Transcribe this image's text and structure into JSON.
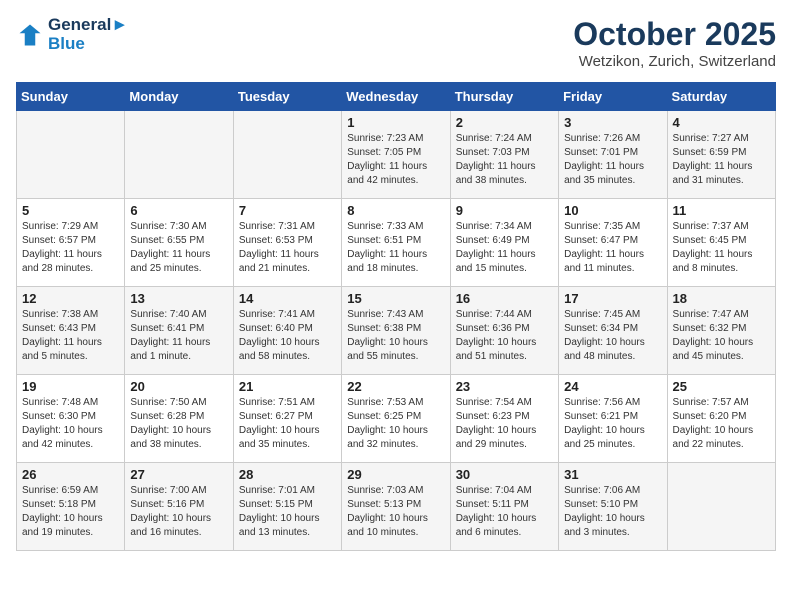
{
  "header": {
    "logo_line1": "General",
    "logo_line2": "Blue",
    "month": "October 2025",
    "location": "Wetzikon, Zurich, Switzerland"
  },
  "days_of_week": [
    "Sunday",
    "Monday",
    "Tuesday",
    "Wednesday",
    "Thursday",
    "Friday",
    "Saturday"
  ],
  "weeks": [
    [
      {
        "day": "",
        "info": ""
      },
      {
        "day": "",
        "info": ""
      },
      {
        "day": "",
        "info": ""
      },
      {
        "day": "1",
        "info": "Sunrise: 7:23 AM\nSunset: 7:05 PM\nDaylight: 11 hours\nand 42 minutes."
      },
      {
        "day": "2",
        "info": "Sunrise: 7:24 AM\nSunset: 7:03 PM\nDaylight: 11 hours\nand 38 minutes."
      },
      {
        "day": "3",
        "info": "Sunrise: 7:26 AM\nSunset: 7:01 PM\nDaylight: 11 hours\nand 35 minutes."
      },
      {
        "day": "4",
        "info": "Sunrise: 7:27 AM\nSunset: 6:59 PM\nDaylight: 11 hours\nand 31 minutes."
      }
    ],
    [
      {
        "day": "5",
        "info": "Sunrise: 7:29 AM\nSunset: 6:57 PM\nDaylight: 11 hours\nand 28 minutes."
      },
      {
        "day": "6",
        "info": "Sunrise: 7:30 AM\nSunset: 6:55 PM\nDaylight: 11 hours\nand 25 minutes."
      },
      {
        "day": "7",
        "info": "Sunrise: 7:31 AM\nSunset: 6:53 PM\nDaylight: 11 hours\nand 21 minutes."
      },
      {
        "day": "8",
        "info": "Sunrise: 7:33 AM\nSunset: 6:51 PM\nDaylight: 11 hours\nand 18 minutes."
      },
      {
        "day": "9",
        "info": "Sunrise: 7:34 AM\nSunset: 6:49 PM\nDaylight: 11 hours\nand 15 minutes."
      },
      {
        "day": "10",
        "info": "Sunrise: 7:35 AM\nSunset: 6:47 PM\nDaylight: 11 hours\nand 11 minutes."
      },
      {
        "day": "11",
        "info": "Sunrise: 7:37 AM\nSunset: 6:45 PM\nDaylight: 11 hours\nand 8 minutes."
      }
    ],
    [
      {
        "day": "12",
        "info": "Sunrise: 7:38 AM\nSunset: 6:43 PM\nDaylight: 11 hours\nand 5 minutes."
      },
      {
        "day": "13",
        "info": "Sunrise: 7:40 AM\nSunset: 6:41 PM\nDaylight: 11 hours\nand 1 minute."
      },
      {
        "day": "14",
        "info": "Sunrise: 7:41 AM\nSunset: 6:40 PM\nDaylight: 10 hours\nand 58 minutes."
      },
      {
        "day": "15",
        "info": "Sunrise: 7:43 AM\nSunset: 6:38 PM\nDaylight: 10 hours\nand 55 minutes."
      },
      {
        "day": "16",
        "info": "Sunrise: 7:44 AM\nSunset: 6:36 PM\nDaylight: 10 hours\nand 51 minutes."
      },
      {
        "day": "17",
        "info": "Sunrise: 7:45 AM\nSunset: 6:34 PM\nDaylight: 10 hours\nand 48 minutes."
      },
      {
        "day": "18",
        "info": "Sunrise: 7:47 AM\nSunset: 6:32 PM\nDaylight: 10 hours\nand 45 minutes."
      }
    ],
    [
      {
        "day": "19",
        "info": "Sunrise: 7:48 AM\nSunset: 6:30 PM\nDaylight: 10 hours\nand 42 minutes."
      },
      {
        "day": "20",
        "info": "Sunrise: 7:50 AM\nSunset: 6:28 PM\nDaylight: 10 hours\nand 38 minutes."
      },
      {
        "day": "21",
        "info": "Sunrise: 7:51 AM\nSunset: 6:27 PM\nDaylight: 10 hours\nand 35 minutes."
      },
      {
        "day": "22",
        "info": "Sunrise: 7:53 AM\nSunset: 6:25 PM\nDaylight: 10 hours\nand 32 minutes."
      },
      {
        "day": "23",
        "info": "Sunrise: 7:54 AM\nSunset: 6:23 PM\nDaylight: 10 hours\nand 29 minutes."
      },
      {
        "day": "24",
        "info": "Sunrise: 7:56 AM\nSunset: 6:21 PM\nDaylight: 10 hours\nand 25 minutes."
      },
      {
        "day": "25",
        "info": "Sunrise: 7:57 AM\nSunset: 6:20 PM\nDaylight: 10 hours\nand 22 minutes."
      }
    ],
    [
      {
        "day": "26",
        "info": "Sunrise: 6:59 AM\nSunset: 5:18 PM\nDaylight: 10 hours\nand 19 minutes."
      },
      {
        "day": "27",
        "info": "Sunrise: 7:00 AM\nSunset: 5:16 PM\nDaylight: 10 hours\nand 16 minutes."
      },
      {
        "day": "28",
        "info": "Sunrise: 7:01 AM\nSunset: 5:15 PM\nDaylight: 10 hours\nand 13 minutes."
      },
      {
        "day": "29",
        "info": "Sunrise: 7:03 AM\nSunset: 5:13 PM\nDaylight: 10 hours\nand 10 minutes."
      },
      {
        "day": "30",
        "info": "Sunrise: 7:04 AM\nSunset: 5:11 PM\nDaylight: 10 hours\nand 6 minutes."
      },
      {
        "day": "31",
        "info": "Sunrise: 7:06 AM\nSunset: 5:10 PM\nDaylight: 10 hours\nand 3 minutes."
      },
      {
        "day": "",
        "info": ""
      }
    ]
  ]
}
